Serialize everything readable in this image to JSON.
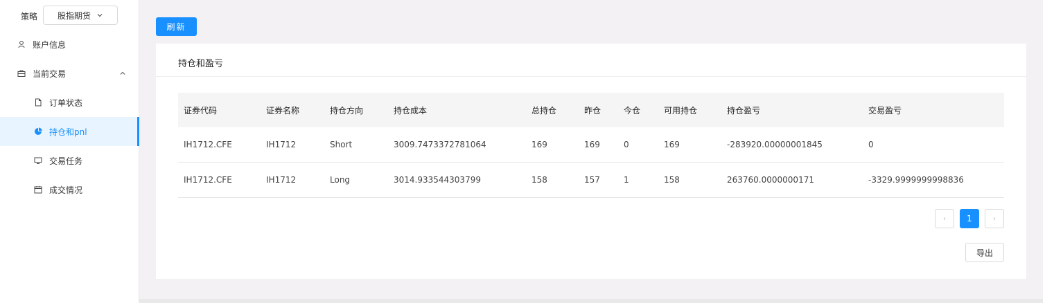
{
  "sidebar": {
    "strategy_label": "策略",
    "strategy_value": "股指期货",
    "items": [
      {
        "label": "账户信息",
        "icon": "user-icon"
      },
      {
        "label": "当前交易",
        "icon": "briefcase-icon"
      },
      {
        "label": "订单状态",
        "icon": "file-icon"
      },
      {
        "label": "持仓和pnl",
        "icon": "pie-chart-icon"
      },
      {
        "label": "交易任务",
        "icon": "monitor-icon"
      },
      {
        "label": "成交情况",
        "icon": "calendar-icon"
      }
    ]
  },
  "toolbar": {
    "refresh_label": "刷新"
  },
  "card": {
    "title": "持仓和盈亏",
    "columns": [
      "证券代码",
      "证券名称",
      "持仓方向",
      "持仓成本",
      "总持仓",
      "昨仓",
      "今仓",
      "可用持仓",
      "持仓盈亏",
      "交易盈亏"
    ],
    "rows": [
      [
        "IH1712.CFE",
        "IH1712",
        "Short",
        "3009.7473372781064",
        "169",
        "169",
        "0",
        "169",
        "-283920.00000001845",
        "0"
      ],
      [
        "IH1712.CFE",
        "IH1712",
        "Long",
        "3014.933544303799",
        "158",
        "157",
        "1",
        "158",
        "263760.0000000171",
        "-3329.9999999998836"
      ]
    ],
    "pagination": {
      "prev": "‹",
      "current": "1",
      "next": "›"
    },
    "export_label": "导出"
  },
  "colors": {
    "accent": "#1890ff",
    "active_bg": "#e8f4ff",
    "page_bg": "#f4f1f4"
  }
}
